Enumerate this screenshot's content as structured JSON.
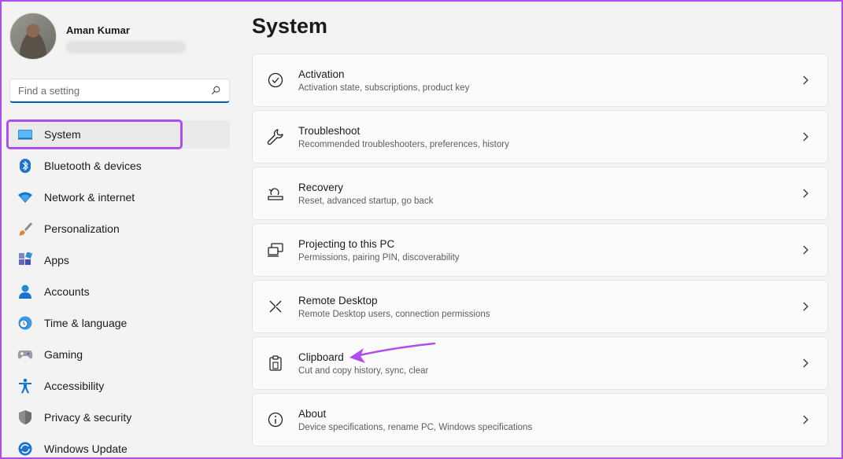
{
  "profile": {
    "name": "Aman Kumar"
  },
  "search": {
    "placeholder": "Find a setting"
  },
  "nav": {
    "items": [
      {
        "label": "System",
        "icon": "system-icon"
      },
      {
        "label": "Bluetooth & devices",
        "icon": "bluetooth-icon"
      },
      {
        "label": "Network & internet",
        "icon": "wifi-icon"
      },
      {
        "label": "Personalization",
        "icon": "brush-icon"
      },
      {
        "label": "Apps",
        "icon": "apps-icon"
      },
      {
        "label": "Accounts",
        "icon": "person-icon"
      },
      {
        "label": "Time & language",
        "icon": "clock-globe-icon"
      },
      {
        "label": "Gaming",
        "icon": "gamepad-icon"
      },
      {
        "label": "Accessibility",
        "icon": "accessibility-icon"
      },
      {
        "label": "Privacy & security",
        "icon": "shield-icon"
      },
      {
        "label": "Windows Update",
        "icon": "update-icon"
      }
    ]
  },
  "main": {
    "title": "System",
    "cards": [
      {
        "title": "Activation",
        "subtitle": "Activation state, subscriptions, product key",
        "icon": "check-circle-icon"
      },
      {
        "title": "Troubleshoot",
        "subtitle": "Recommended troubleshooters, preferences, history",
        "icon": "wrench-icon"
      },
      {
        "title": "Recovery",
        "subtitle": "Reset, advanced startup, go back",
        "icon": "recovery-icon"
      },
      {
        "title": "Projecting to this PC",
        "subtitle": "Permissions, pairing PIN, discoverability",
        "icon": "projecting-icon"
      },
      {
        "title": "Remote Desktop",
        "subtitle": "Remote Desktop users, connection permissions",
        "icon": "remote-desktop-icon"
      },
      {
        "title": "Clipboard",
        "subtitle": "Cut and copy history, sync, clear",
        "icon": "clipboard-icon"
      },
      {
        "title": "About",
        "subtitle": "Device specifications, rename PC, Windows specifications",
        "icon": "info-icon"
      }
    ]
  },
  "colors": {
    "accent": "#005fb8",
    "highlight": "#b04cf0"
  }
}
